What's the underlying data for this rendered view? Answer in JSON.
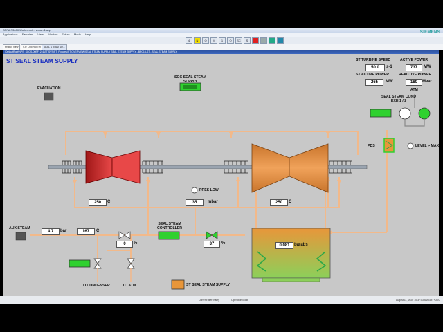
{
  "window": {
    "title": "SPPA-T3000 Workbench - wmam1 app",
    "brand": "SIEMENS",
    "menu": [
      "Applications",
      "Favorites",
      "View",
      "Window",
      "Extras",
      "Mode",
      "Help"
    ],
    "tabs": [
      "Project View",
      "S.P. OVERVIEW",
      "SEAL STEAM SU..."
    ],
    "path": "\\DefaultRoot\\NPS_SCCS-00BF_2x1\\ST\\SVS\\ST_Pictures\\ST OVERVIEW\\SEAL STEAM SUPPLY  SEAL STEAM SUPPLY  - BPC15-ST - SEAL STEAM SUPPLY",
    "toolbar_buttons": [
      "4",
      "N",
      "O",
      "M",
      "1",
      "O",
      "SC",
      "S"
    ]
  },
  "screen": {
    "title": "ST SEAL STEAM SUPPLY",
    "labels": {
      "evacuation": "EVACUATION",
      "sgc_seal_steam_supply": "SGC SEAL STEAM SUPPLY",
      "st_turbine_speed": "ST TURBINE SPEED",
      "active_power": "ACTIVE POWER",
      "st_active_power": "ST ACTIVE POWER",
      "reactive_power": "REACTIVE POWER",
      "atm": "ATM",
      "seal_steam_cond": "SEAL STEAM COND EXH 1 / 2",
      "pds": "PDS",
      "level_max": "LEVEL > MAX",
      "pres_low": "PRES LOW",
      "aux_steam": "AUX STEAM",
      "seal_steam_controller": "SEAL STEAM CONTROLLER",
      "to_condenser": "TO CONDENSER",
      "to_atm": "TO ATM",
      "st_seal_steam_supply": "ST SEAL STEAM SUPPLY"
    },
    "values": {
      "turbine_speed": "50.0",
      "turbine_speed_unit": "s-1",
      "active_power": "737",
      "active_power_unit": "MW",
      "st_active_power": "265",
      "st_active_power_unit": "MW",
      "reactive_power": "180",
      "reactive_power_unit": "Mvar",
      "temp_left": "250",
      "temp_left_unit": "C",
      "pressure_mid": "35",
      "pressure_mid_unit": "mbar",
      "temp_right": "250",
      "temp_right_unit": "C",
      "aux_pressure": "4.7",
      "aux_pressure_unit": "bar",
      "aux_temp": "167",
      "aux_temp_unit": "C",
      "valve_pos_1": "0",
      "valve_pos_1_unit": "%",
      "valve_pos_2": "37",
      "valve_pos_2_unit": "%",
      "condenser_pressure": "0.081",
      "condenser_pressure_unit": "barabs"
    }
  },
  "status": {
    "current_user": "Current user: nakry",
    "mode": "Operation Mode",
    "datetime": "August 11, 2020 10:37:03 AM GMT+08:0"
  },
  "colors": {
    "background": "#c8c8c8",
    "steam_pipe": "#f2b98a",
    "title_blue": "#1a2fc0",
    "green_active": "#2fd12f",
    "hp_turbine": "#c02828",
    "lp_turbine": "#e8893a",
    "condenser_top": "#e8963a",
    "condenser_bottom": "#8cd05a"
  }
}
